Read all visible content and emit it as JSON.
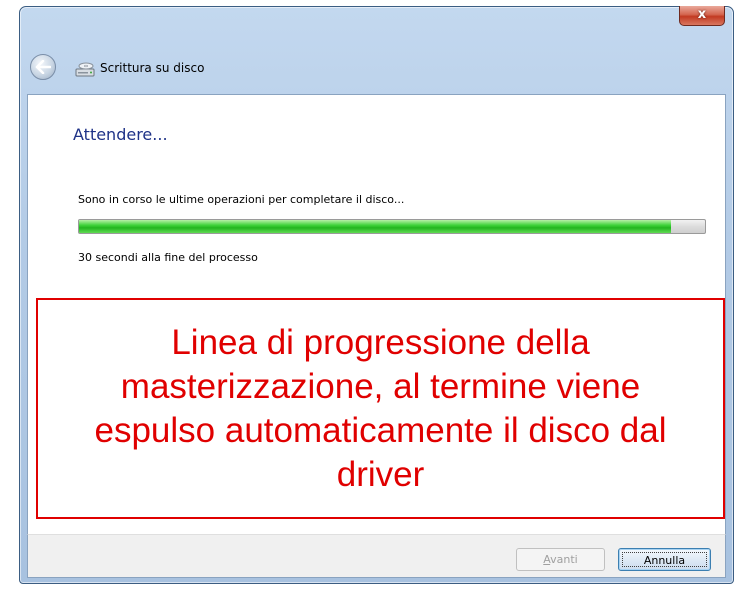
{
  "window": {
    "title": "Scrittura su disco",
    "close_label": "x"
  },
  "content": {
    "heading": "Attendere...",
    "status_text": "Sono in corso le ultime operazioni per completare il disco...",
    "progress_fraction": 0.945,
    "remaining_text": "30 secondi alla fine del processo"
  },
  "annotation": {
    "text": "Linea di progressione della masterizzazione, al termine viene espulso automaticamente il disco dal driver",
    "color": "#e00000"
  },
  "footer": {
    "next_label_accel": "A",
    "next_label_rest": "vanti",
    "cancel_label": "Annulla"
  },
  "colors": {
    "heading": "#1e3287",
    "progress": "#23b51f"
  }
}
